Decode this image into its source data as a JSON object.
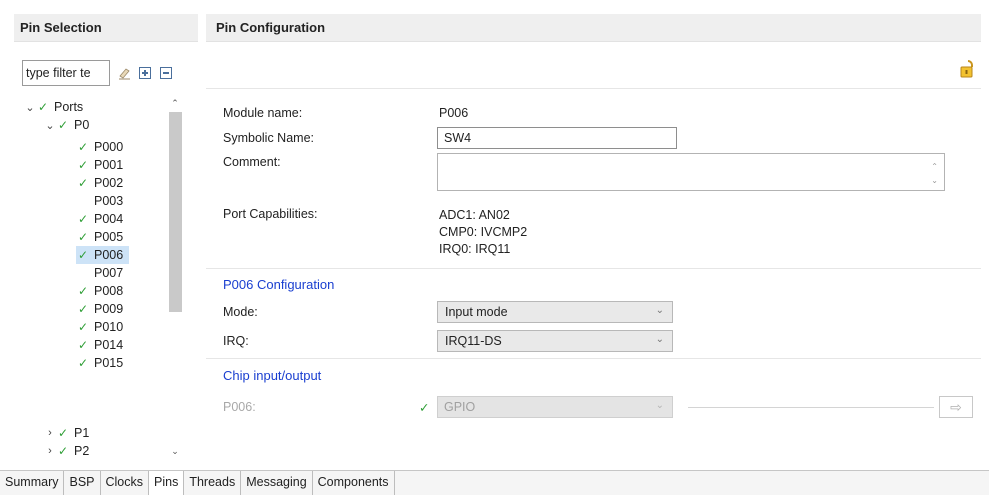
{
  "pin_selection": {
    "title": "Pin Selection",
    "filter_value": "type filter te",
    "tools": [
      "clear-filter-icon",
      "expand-all-icon",
      "collapse-all-icon"
    ]
  },
  "tree": {
    "ports_label": "Ports",
    "p0_label": "P0",
    "p0_pins": [
      {
        "label": "P000",
        "checked": true
      },
      {
        "label": "P001",
        "checked": true
      },
      {
        "label": "P002",
        "checked": true
      },
      {
        "label": "P003",
        "checked": false
      },
      {
        "label": "P004",
        "checked": true
      },
      {
        "label": "P005",
        "checked": true
      },
      {
        "label": "P006",
        "checked": true,
        "selected": true
      },
      {
        "label": "P007",
        "checked": false
      },
      {
        "label": "P008",
        "checked": true
      },
      {
        "label": "P009",
        "checked": true
      },
      {
        "label": "P010",
        "checked": true
      },
      {
        "label": "P014",
        "checked": true
      },
      {
        "label": "P015",
        "checked": true
      }
    ],
    "p1_label": "P1",
    "p2_label": "P2"
  },
  "pin_config": {
    "title": "Pin Configuration",
    "module_name_label": "Module name:",
    "module_name_value": "P006",
    "symbolic_name_label": "Symbolic Name:",
    "symbolic_name_value": "SW4",
    "comment_label": "Comment:",
    "comment_value": "",
    "port_capabilities_label": "Port Capabilities:",
    "port_capabilities": [
      "ADC1: AN02",
      "CMP0: IVCMP2",
      "IRQ0: IRQ11"
    ],
    "config_section_title": "P006 Configuration",
    "mode_label": "Mode:",
    "mode_value": "Input mode",
    "irq_label": "IRQ:",
    "irq_value": "IRQ11-DS",
    "chip_io_title": "Chip input/output",
    "chip_pin_label": "P006:",
    "chip_pin_value": "GPIO"
  },
  "tabs": [
    {
      "label": "Summary",
      "active": false
    },
    {
      "label": "BSP",
      "active": false
    },
    {
      "label": "Clocks",
      "active": false
    },
    {
      "label": "Pins",
      "active": true
    },
    {
      "label": "Threads",
      "active": false
    },
    {
      "label": "Messaging",
      "active": false
    },
    {
      "label": "Components",
      "active": false
    }
  ],
  "colors": {
    "accent_blue": "#1a3fd0",
    "check_green": "#2e9e36",
    "selection_bg": "#cde3f7"
  }
}
